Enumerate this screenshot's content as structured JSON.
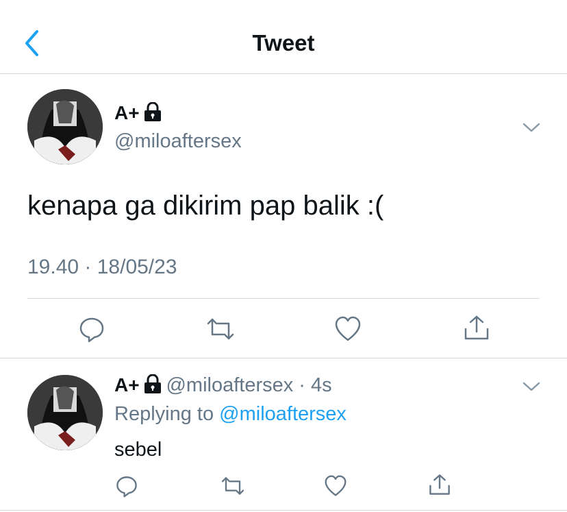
{
  "header": {
    "title": "Tweet",
    "back_icon": "chevron-left-icon"
  },
  "main_tweet": {
    "display_name": "A+",
    "handle": "@miloaftersex",
    "text": "kenapa ga dikirim pap balik :(",
    "timestamp": "19.40 · 18/05/23",
    "actions": [
      "reply-icon",
      "retweet-icon",
      "like-icon",
      "share-icon"
    ]
  },
  "reply": {
    "display_name": "A+",
    "handle_time": "@miloaftersex · 4s",
    "replying_prefix": "Replying to",
    "replying_handle": "@miloaftersex",
    "text": "sebel",
    "actions": [
      "reply-icon",
      "retweet-icon",
      "like-icon",
      "share-icon"
    ]
  },
  "colors": {
    "accent": "#1da1f2",
    "secondary_text": "#657786",
    "divider": "#d6d9db"
  }
}
